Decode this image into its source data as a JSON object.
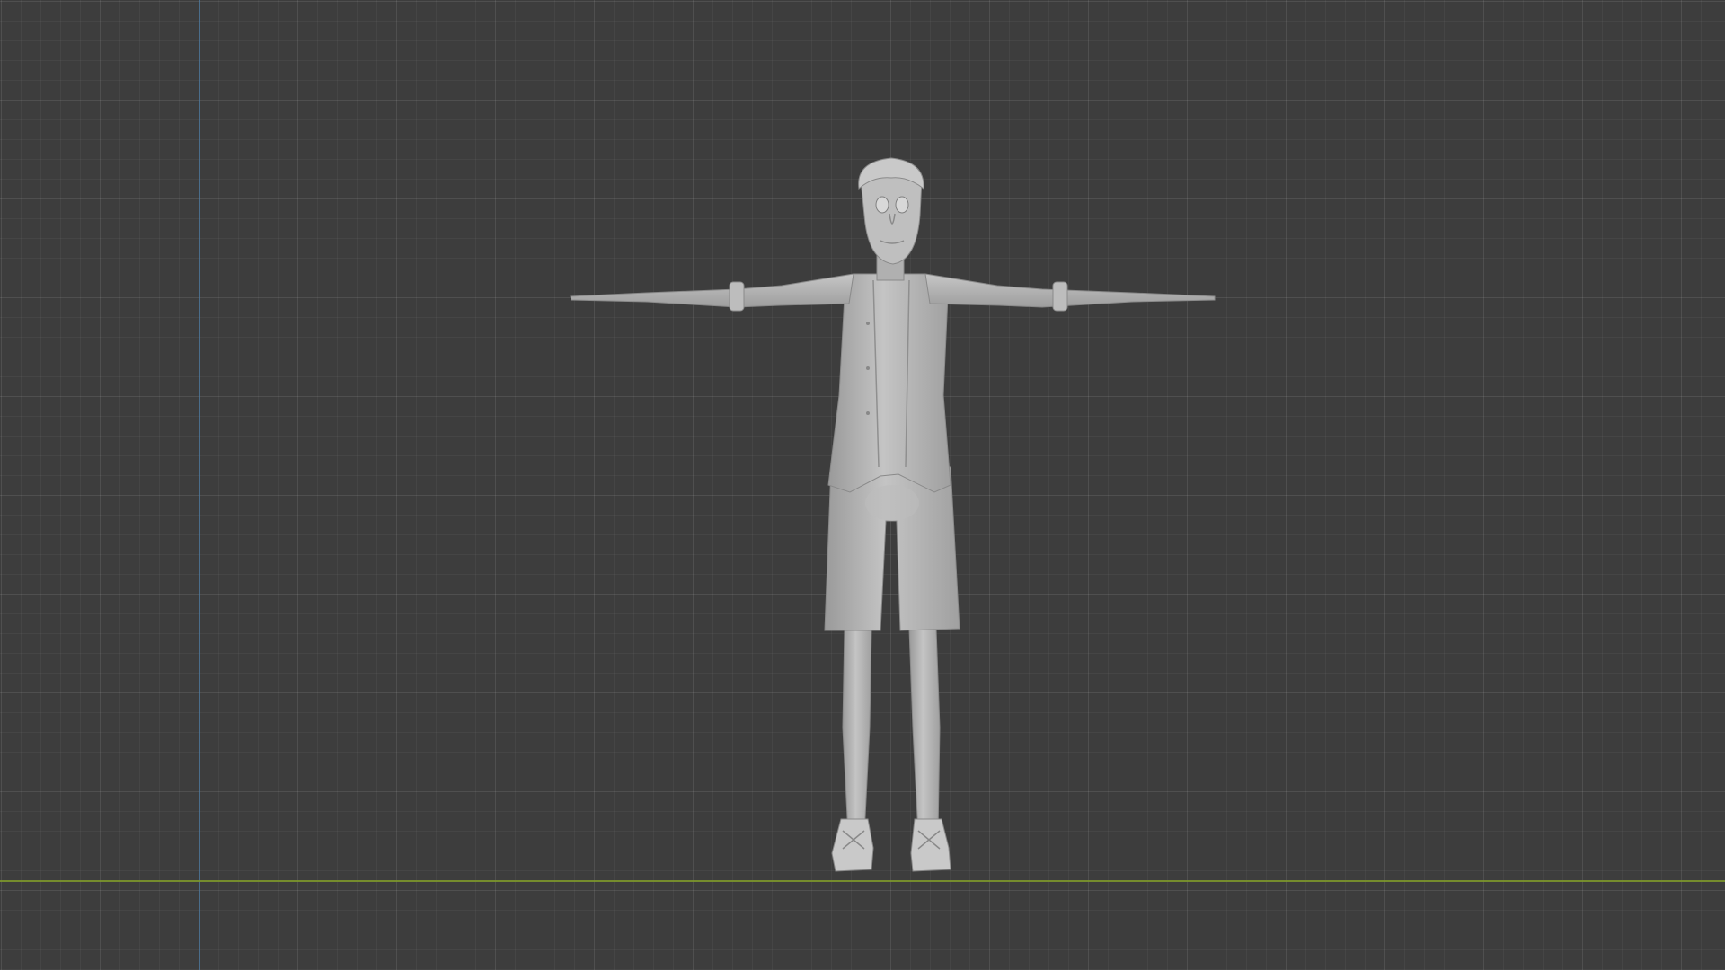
{
  "viewport": {
    "view": "front-orthographic",
    "background_color": "#3d3d3d",
    "grid": true,
    "axis_colors": {
      "vertical_axis": "#4f7da6",
      "horizontal_axis": "#7f9a2a"
    }
  },
  "model": {
    "icon": "character-mesh-icon",
    "pose": "t-pose",
    "shading": "solid",
    "mesh_color": "#b8b8b8"
  }
}
